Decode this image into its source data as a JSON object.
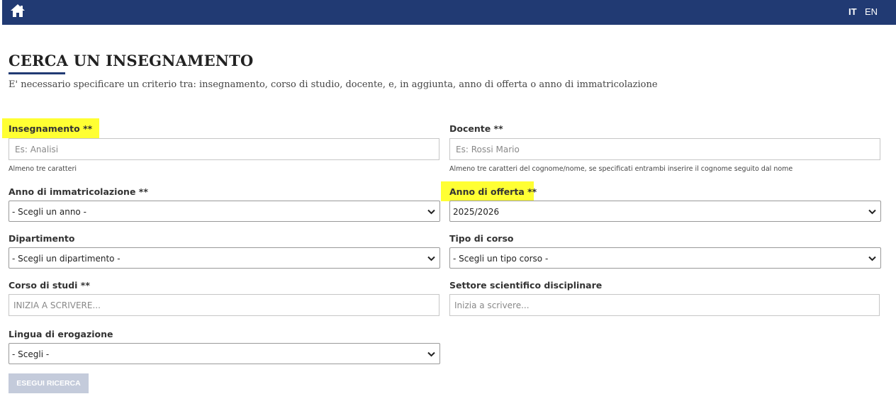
{
  "header": {
    "home_icon": "home-icon",
    "lang_it": "IT",
    "lang_en": "EN",
    "bg_color": "#213a73"
  },
  "page": {
    "title": "CERCA UN INSEGNAMENTO",
    "subtitle": "E' necessario specificare un criterio tra: insegnamento, corso di studio, docente, e, in aggiunta, anno di offerta o anno di immatricolazione"
  },
  "form": {
    "insegnamento": {
      "label": "Insegnamento **",
      "placeholder": "Es: Analisi",
      "help": "Almeno tre caratteri"
    },
    "docente": {
      "label": "Docente **",
      "placeholder": "Es: Rossi Mario",
      "help": "Almeno tre caratteri del cognome/nome, se specificati entrambi inserire il cognome seguito dal nome"
    },
    "anno_immatricolazione": {
      "label": "Anno di immatricolazione **",
      "value": "- Scegli un anno -"
    },
    "anno_offerta": {
      "label": "Anno di offerta **",
      "value": "2025/2026"
    },
    "dipartimento": {
      "label": "Dipartimento",
      "value": "- Scegli un dipartimento -"
    },
    "tipo_corso": {
      "label": "Tipo di corso",
      "value": "- Scegli un tipo corso -"
    },
    "corso_studi": {
      "label": "Corso di studi **",
      "placeholder": "INIZIA A SCRIVERE..."
    },
    "settore": {
      "label": "Settore scientifico disciplinare",
      "placeholder": "Inizia a scrivere..."
    },
    "lingua": {
      "label": "Lingua di erogazione",
      "value": "- Scegli -"
    },
    "submit_label": "ESEGUI RICERCA",
    "highlight_color": "#ffff33"
  }
}
